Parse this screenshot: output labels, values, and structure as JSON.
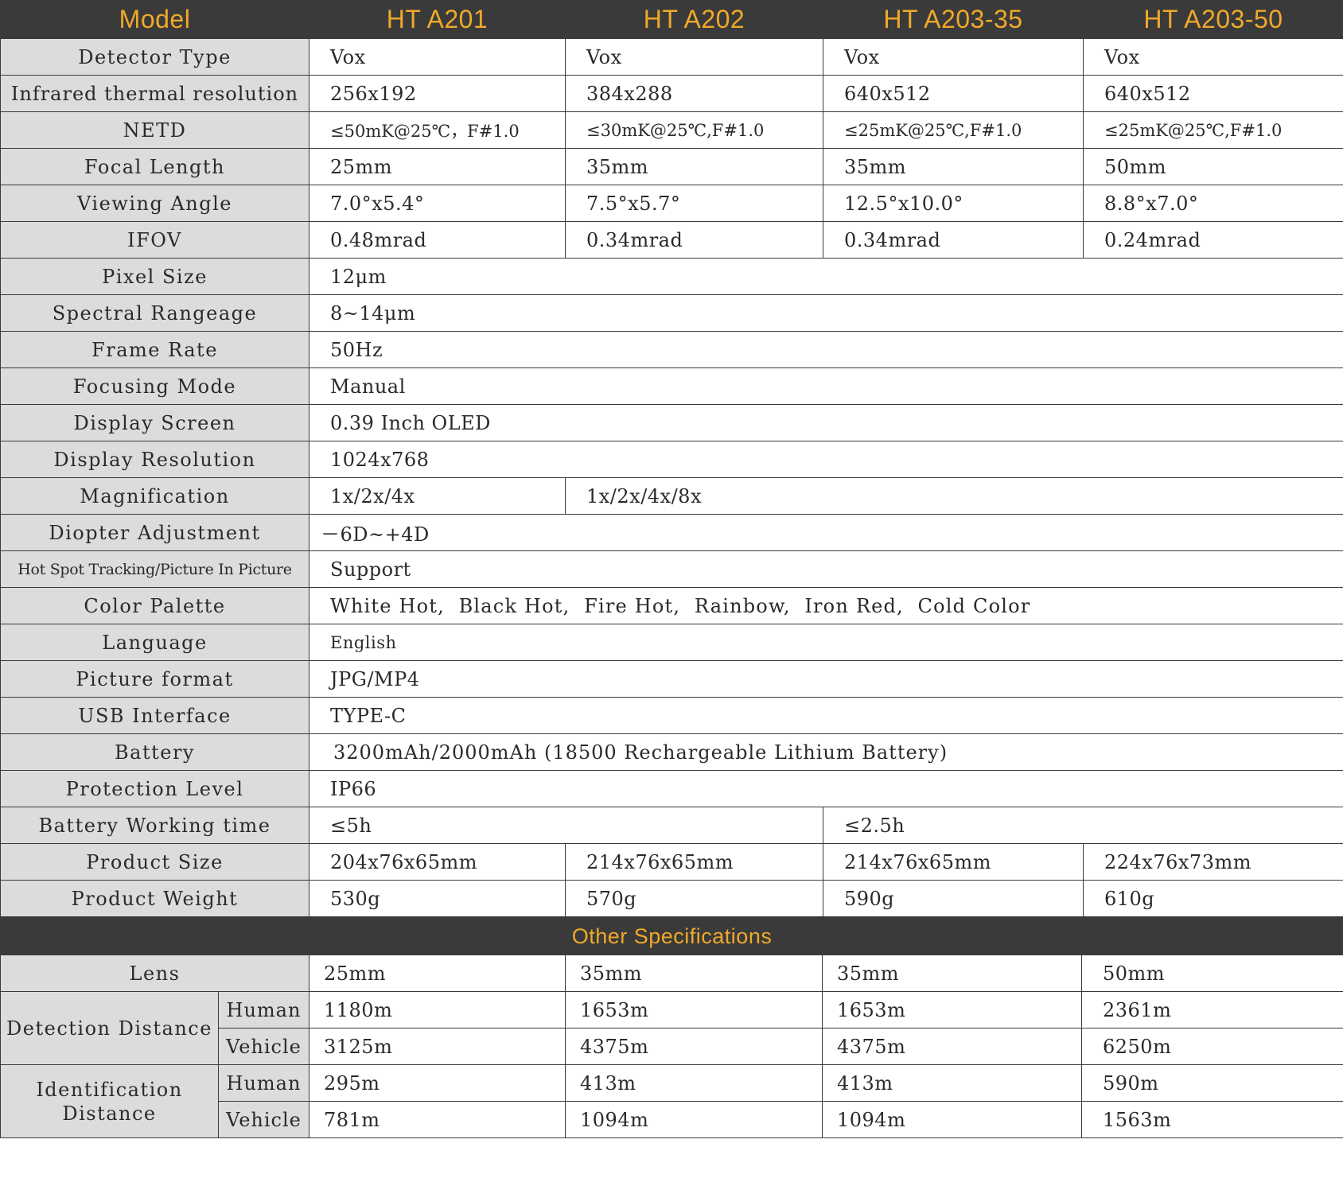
{
  "header": {
    "model_label": "Model",
    "models": [
      "HT A201",
      "HT A202",
      "HT A203-35",
      "HT A203-50"
    ]
  },
  "specs": {
    "detector_type": {
      "label": "Detector Type",
      "values": [
        "Vox",
        "Vox",
        "Vox",
        "Vox"
      ]
    },
    "resolution": {
      "label": "Infrared thermal resolution",
      "values": [
        "256x192",
        "384x288",
        "640x512",
        "640x512"
      ]
    },
    "netd": {
      "label": "NETD",
      "values": [
        "≤50mK@25℃，F#1.0",
        "≤30mK@25℃,F#1.0",
        "≤25mK@25℃,F#1.0",
        "≤25mK@25℃,F#1.0"
      ]
    },
    "focal_length": {
      "label": "Focal Length",
      "values": [
        "25mm",
        "35mm",
        "35mm",
        "50mm"
      ]
    },
    "viewing_angle": {
      "label": "Viewing Angle",
      "values": [
        "7.0°x5.4°",
        "7.5°x5.7°",
        "12.5°x10.0°",
        "8.8°x7.0°"
      ]
    },
    "ifov": {
      "label": "IFOV",
      "values": [
        "0.48mrad",
        "0.34mrad",
        "0.34mrad",
        "0.24mrad"
      ]
    },
    "pixel_size": {
      "label": "Pixel Size",
      "value": "12μm"
    },
    "spectral": {
      "label": "Spectral Rangeage",
      "value": "8~14μm"
    },
    "frame_rate": {
      "label": "Frame Rate",
      "value": "50Hz"
    },
    "focusing": {
      "label": "Focusing Mode",
      "value": "Manual"
    },
    "display_screen": {
      "label": "Display Screen",
      "value": "0.39 Inch OLED"
    },
    "display_resolution": {
      "label": "Display Resolution",
      "value": "1024x768"
    },
    "magnification": {
      "label": "Magnification",
      "values": [
        "1x/2x/4x",
        "1x/2x/4x/8x"
      ]
    },
    "diopter": {
      "label": "Diopter Adjustment",
      "value": "－6D~+4D"
    },
    "hot_spot": {
      "label": "Hot Spot Tracking/Picture In Picture",
      "value": "Support"
    },
    "palette": {
      "label": "Color Palette",
      "value": "White Hot,  Black Hot,  Fire Hot,  Rainbow,  Iron Red,  Cold Color"
    },
    "language": {
      "label": "Language",
      "value": "English"
    },
    "picture_format": {
      "label": "Picture format",
      "value": "JPG/MP4"
    },
    "usb": {
      "label": "USB Interface",
      "value": "TYPE-C"
    },
    "battery": {
      "label": "Battery",
      "value": "3200mAh/2000mAh (18500 Rechargeable Lithium Battery)"
    },
    "protection": {
      "label": "Protection Level",
      "value": "IP66"
    },
    "working_time": {
      "label": "Battery Working time",
      "values": [
        "≤5h",
        "≤2.5h"
      ]
    },
    "product_size": {
      "label": "Product Size",
      "values": [
        "204x76x65mm",
        "214x76x65mm",
        "214x76x65mm",
        "224x76x73mm"
      ]
    },
    "product_weight": {
      "label": "Product Weight",
      "values": [
        "530g",
        "570g",
        "590g",
        "610g"
      ]
    }
  },
  "other": {
    "title": "Other Specifications",
    "lens": {
      "label": "Lens",
      "values": [
        "25mm",
        "35mm",
        "35mm",
        "50mm"
      ]
    },
    "detection": {
      "label": "Detection Distance",
      "human": {
        "label": "Human",
        "values": [
          "1180m",
          "1653m",
          "1653m",
          "2361m"
        ]
      },
      "vehicle": {
        "label": "Vehicle",
        "values": [
          "3125m",
          "4375m",
          "4375m",
          "6250m"
        ]
      }
    },
    "identification": {
      "label": "Identification Distance",
      "human": {
        "label": "Human",
        "values": [
          "295m",
          "413m",
          "413m",
          "590m"
        ]
      },
      "vehicle": {
        "label": "Vehicle",
        "values": [
          "781m",
          "1094m",
          "1094m",
          "1563m"
        ]
      }
    }
  }
}
